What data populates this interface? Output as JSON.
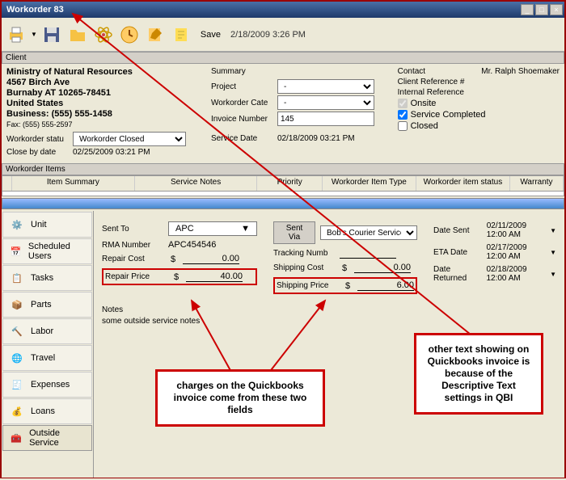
{
  "window": {
    "title": "Workorder 83"
  },
  "toolbar": {
    "save": "Save",
    "timestamp": "2/18/2009 3:26 PM"
  },
  "client_header": "Client",
  "address": {
    "name": "Ministry of Natural Resources",
    "street": "4567 Birch Ave",
    "city": "Burnaby AT 10265-78451",
    "country": "United States",
    "business": "Business: (555) 555-1458",
    "fax": "Fax: (555) 555-2597"
  },
  "status": {
    "label": "Workorder statu",
    "value": "Workorder Closed"
  },
  "closeby": {
    "label": "Close by date",
    "value": "02/25/2009 03:21 PM"
  },
  "summary": {
    "header": "Summary",
    "project_lbl": "Project",
    "project_val": "-",
    "cat_lbl": "Workorder Cate",
    "cat_val": "-",
    "inv_lbl": "Invoice Number",
    "inv_val": "145",
    "svc_lbl": "Service Date",
    "svc_val": "02/18/2009 03:21 PM"
  },
  "contact": {
    "header": "Contact",
    "name": "Mr. Ralph Shoemaker",
    "ref_lbl": "Client Reference #",
    "int_lbl": "Internal Reference",
    "onsite": "Onsite",
    "completed": "Service Completed",
    "closed": "Closed"
  },
  "items_header": "Workorder Items",
  "gridcols": [
    "Item Summary",
    "Service Notes",
    "Priority",
    "Workorder Item Type",
    "Workorder item status",
    "Warranty"
  ],
  "sidebar": [
    "Unit",
    "Scheduled Users",
    "Tasks",
    "Parts",
    "Labor",
    "Travel",
    "Expenses",
    "Loans",
    "Outside Service"
  ],
  "detail": {
    "sentto_lbl": "Sent To",
    "sentto_val": "APC",
    "sentvia_lbl": "Sent Via",
    "sentvia_val": "Bob's Courier Service",
    "rma_lbl": "RMA Number",
    "rma_val": "APC454546",
    "track_lbl": "Tracking Numb",
    "track_val": "",
    "repcost_lbl": "Repair Cost",
    "repcost_val": "0.00",
    "shipcost_lbl": "Shipping Cost",
    "shipcost_val": "0.00",
    "repprice_lbl": "Repair Price",
    "repprice_val": "40.00",
    "shipprice_lbl": "Shipping Price",
    "shipprice_val": "6.00",
    "datesent_lbl": "Date Sent",
    "datesent_val": "02/11/2009 12:00 AM",
    "eta_lbl": "ETA Date",
    "eta_val": "02/17/2009 12:00 AM",
    "ret_lbl": "Date Returned",
    "ret_val": "02/18/2009 12:00 AM",
    "notes_lbl": "Notes",
    "notes_val": "some outside service notes",
    "cur": "$"
  },
  "callouts": {
    "left": "charges on the Quickbooks invoice come from these two fields",
    "right": "other text showing on Quickbooks invoice is because of the Descriptive Text settings in QBI"
  }
}
